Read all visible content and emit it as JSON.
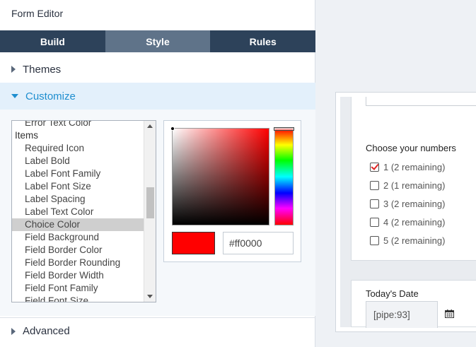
{
  "editor": {
    "title": "Form Editor",
    "tabs": [
      {
        "label": "Build",
        "active": false
      },
      {
        "label": "Style",
        "active": true
      },
      {
        "label": "Rules",
        "active": false
      }
    ],
    "sections": {
      "themes": "Themes",
      "customize": "Customize",
      "advanced": "Advanced"
    }
  },
  "property_list": {
    "items": [
      {
        "label": "Error Text Color",
        "group": false,
        "selected": false
      },
      {
        "label": "Items",
        "group": true,
        "selected": false
      },
      {
        "label": "Required Icon",
        "group": false,
        "selected": false
      },
      {
        "label": "Label Bold",
        "group": false,
        "selected": false
      },
      {
        "label": "Label Font Family",
        "group": false,
        "selected": false
      },
      {
        "label": "Label Font Size",
        "group": false,
        "selected": false
      },
      {
        "label": "Label Spacing",
        "group": false,
        "selected": false
      },
      {
        "label": "Label Text Color",
        "group": false,
        "selected": false
      },
      {
        "label": "Choice Color",
        "group": false,
        "selected": true
      },
      {
        "label": "Field Background",
        "group": false,
        "selected": false
      },
      {
        "label": "Field Border Color",
        "group": false,
        "selected": false
      },
      {
        "label": "Field Border Rounding",
        "group": false,
        "selected": false
      },
      {
        "label": "Field Border Width",
        "group": false,
        "selected": false
      },
      {
        "label": "Field Font Family",
        "group": false,
        "selected": false
      },
      {
        "label": "Field Font Size",
        "group": false,
        "selected": false
      }
    ]
  },
  "color_picker": {
    "hex_value": "#ff0000",
    "selected_color": "#ff0000"
  },
  "preview": {
    "choices_label": "Choose your numbers",
    "choices": [
      {
        "label": "1 (2 remaining)",
        "checked": true
      },
      {
        "label": "2 (1 remaining)",
        "checked": false
      },
      {
        "label": "3 (2 remaining)",
        "checked": false
      },
      {
        "label": "4 (2 remaining)",
        "checked": false
      },
      {
        "label": "5 (2 remaining)",
        "checked": false
      }
    ],
    "date_label": "Today's Date",
    "date_value": "[pipe:93]"
  },
  "colors": {
    "tab_bar": "#2d425a",
    "tab_active": "#5f7389",
    "accent": "#1e8ecf",
    "check_mark": "#e02424"
  }
}
